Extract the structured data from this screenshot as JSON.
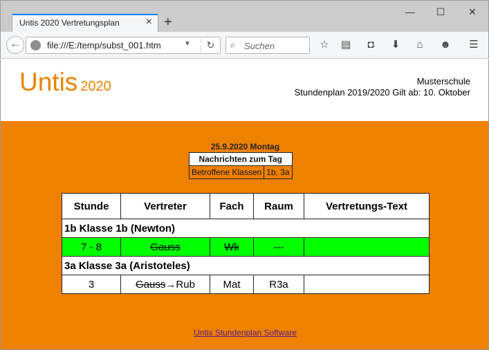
{
  "browser": {
    "tab_title": "Untis 2020 Vertretungsplan",
    "url": "file:///E:/temp/subst_001.htm",
    "search_placeholder": "Suchen"
  },
  "header": {
    "logo_main": "Untis",
    "logo_year": "2020",
    "school_name": "Musterschule",
    "plan_line": "Stundenplan 2019/2020 Gilt ab: 10. Oktober"
  },
  "day": {
    "date_title": "25.9.2020 Montag",
    "news_header": "Nachrichten zum Tag",
    "news_label": "Betroffene Klassen",
    "news_value": "1b, 3a"
  },
  "table": {
    "columns": [
      "Stunde",
      "Vertreter",
      "Fach",
      "Raum",
      "Vertretungs-Text"
    ],
    "groups": [
      {
        "title": "1b Klasse 1b (Newton)",
        "row": {
          "stunde": "7 - 8",
          "vertreter": "Gauss",
          "vertreter_new": "",
          "fach": "Wk",
          "raum": "---",
          "text": ""
        }
      },
      {
        "title": "3a Klasse 3a (Aristoteles)",
        "row": {
          "stunde": "3",
          "vertreter": "Gauss",
          "vertreter_new": "→Rub",
          "fach": "Mat",
          "raum": "R3a",
          "text": ""
        }
      }
    ]
  },
  "footer": {
    "link": "Untis Stundenplan Software"
  },
  "colors": {
    "accent": "#ee8100",
    "logo": "#e98300",
    "cancel_row": "#00ff00",
    "tab_accent": "#0a84ff"
  }
}
